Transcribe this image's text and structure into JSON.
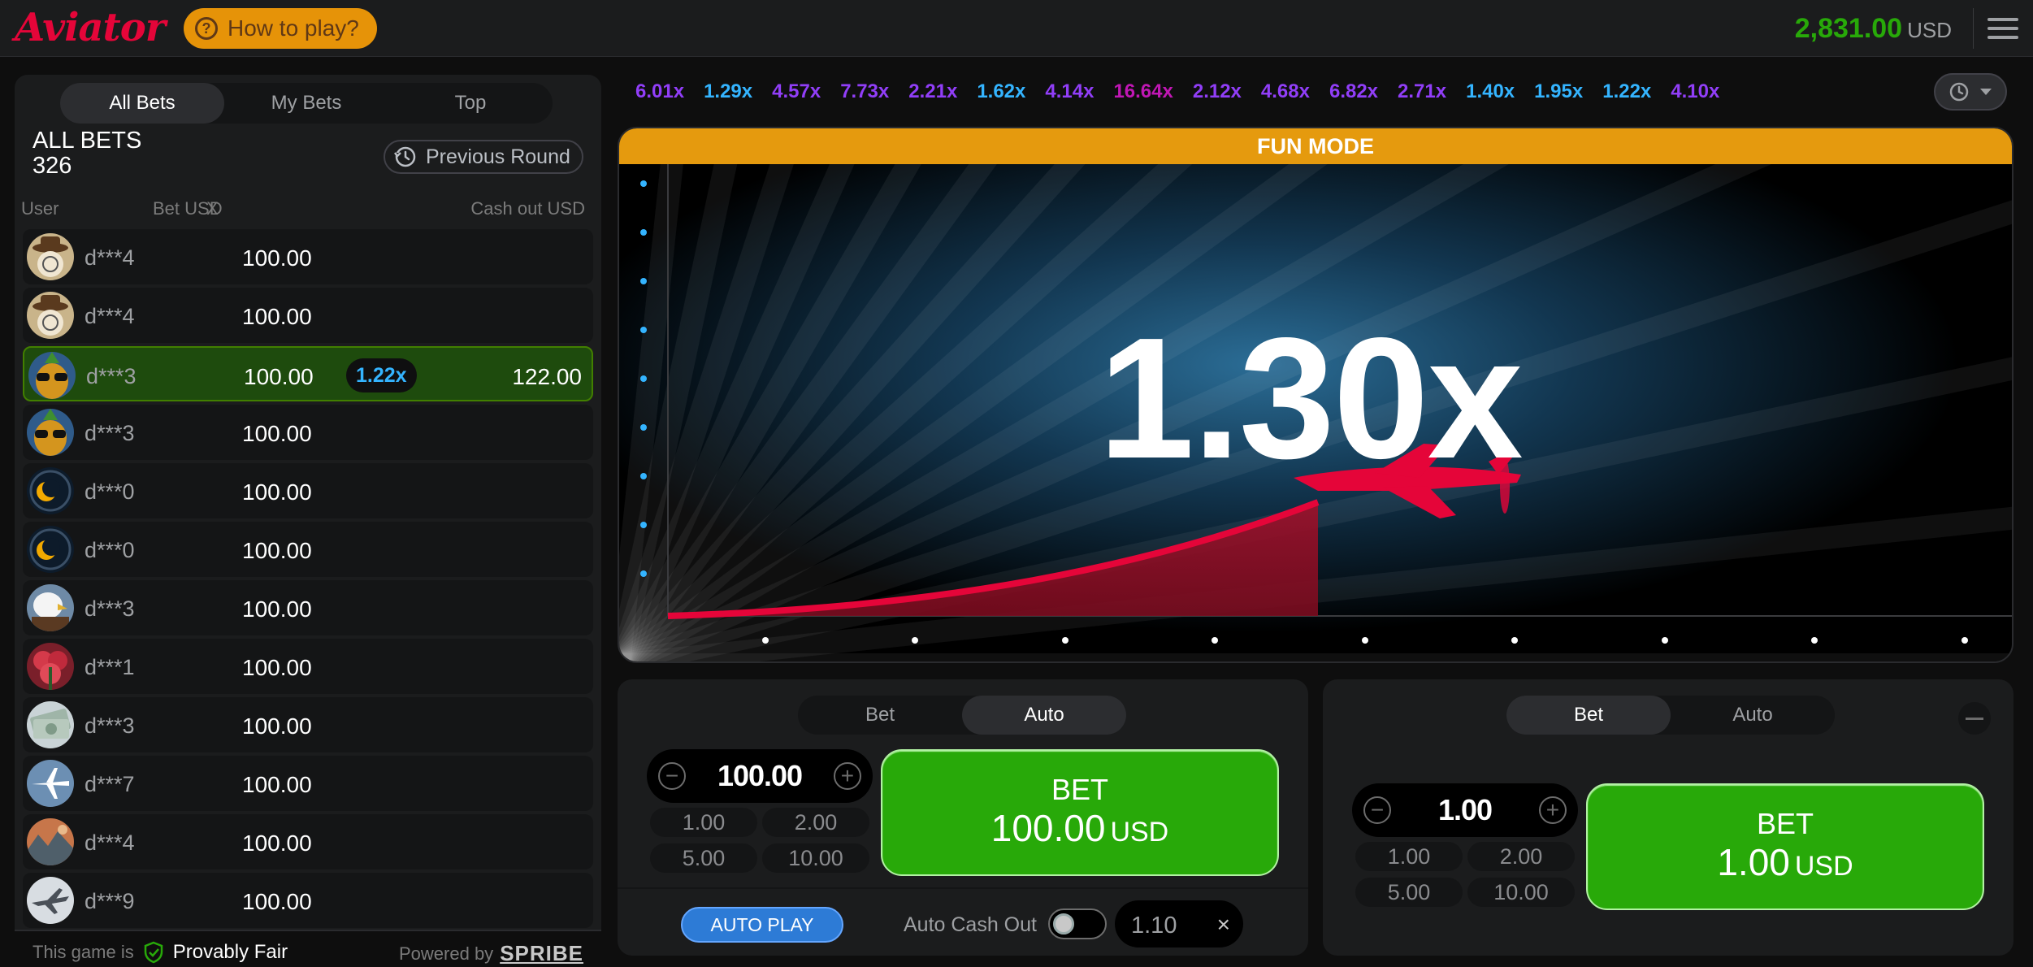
{
  "header": {
    "logo": "Aviator",
    "how_to_play": "How to play?",
    "balance": "2,831.00",
    "currency": "USD"
  },
  "left_panel": {
    "tabs": [
      "All Bets",
      "My Bets",
      "Top"
    ],
    "active_tab": "All Bets",
    "title": "ALL BETS",
    "count": "326",
    "previous_round": "Previous Round",
    "columns": {
      "user": "User",
      "bet": "Bet USD",
      "x": "X",
      "cashout": "Cash out USD"
    },
    "rows": [
      {
        "user": "d***4",
        "bet": "100.00",
        "mult": "",
        "cashout": "",
        "avatar": "cowboy-emoji-avatar",
        "win": false
      },
      {
        "user": "d***4",
        "bet": "100.00",
        "mult": "",
        "cashout": "",
        "avatar": "cowboy-emoji-avatar",
        "win": false
      },
      {
        "user": "d***3",
        "bet": "100.00",
        "mult": "1.22x",
        "cashout": "122.00",
        "avatar": "pineapple-sunglasses-avatar",
        "win": true
      },
      {
        "user": "d***3",
        "bet": "100.00",
        "mult": "",
        "cashout": "",
        "avatar": "pineapple-sunglasses-avatar",
        "win": false
      },
      {
        "user": "d***0",
        "bet": "100.00",
        "mult": "",
        "cashout": "",
        "avatar": "moon-avatar",
        "win": false
      },
      {
        "user": "d***0",
        "bet": "100.00",
        "mult": "",
        "cashout": "",
        "avatar": "moon-avatar",
        "win": false
      },
      {
        "user": "d***3",
        "bet": "100.00",
        "mult": "",
        "cashout": "",
        "avatar": "eagle-avatar",
        "win": false
      },
      {
        "user": "d***1",
        "bet": "100.00",
        "mult": "",
        "cashout": "",
        "avatar": "red-flower-avatar",
        "win": false
      },
      {
        "user": "d***3",
        "bet": "100.00",
        "mult": "",
        "cashout": "",
        "avatar": "dollar-bills-avatar",
        "win": false
      },
      {
        "user": "d***7",
        "bet": "100.00",
        "mult": "",
        "cashout": "",
        "avatar": "airplane-avatar",
        "win": false
      },
      {
        "user": "d***4",
        "bet": "100.00",
        "mult": "",
        "cashout": "",
        "avatar": "rock-landscape-avatar",
        "win": false
      },
      {
        "user": "d***9",
        "bet": "100.00",
        "mult": "",
        "cashout": "",
        "avatar": "fighter-jet-avatar",
        "win": false
      }
    ],
    "footer": {
      "game_is": "This game is",
      "provably_fair": "Provably Fair",
      "powered_by": "Powered by",
      "brand": "SPRIBE"
    }
  },
  "history": [
    {
      "value": "6.01x",
      "color": "#913ef8"
    },
    {
      "value": "1.29x",
      "color": "#34b4ff"
    },
    {
      "value": "4.57x",
      "color": "#913ef8"
    },
    {
      "value": "7.73x",
      "color": "#913ef8"
    },
    {
      "value": "2.21x",
      "color": "#913ef8"
    },
    {
      "value": "1.62x",
      "color": "#34b4ff"
    },
    {
      "value": "4.14x",
      "color": "#913ef8"
    },
    {
      "value": "16.64x",
      "color": "#c017b4"
    },
    {
      "value": "2.12x",
      "color": "#913ef8"
    },
    {
      "value": "4.68x",
      "color": "#913ef8"
    },
    {
      "value": "6.82x",
      "color": "#913ef8"
    },
    {
      "value": "2.71x",
      "color": "#913ef8"
    },
    {
      "value": "1.40x",
      "color": "#34b4ff"
    },
    {
      "value": "1.95x",
      "color": "#34b4ff"
    },
    {
      "value": "1.22x",
      "color": "#34b4ff"
    },
    {
      "value": "4.10x",
      "color": "#913ef8"
    }
  ],
  "game": {
    "mode_banner": "FUN MODE",
    "multiplier": "1.30x",
    "plane_color": "#e50539"
  },
  "panel1": {
    "tabs": [
      "Bet",
      "Auto"
    ],
    "active_tab": "Auto",
    "amount": "100.00",
    "quick": [
      "1.00",
      "2.00",
      "5.00",
      "10.00"
    ],
    "bet_label": "BET",
    "bet_amount": "100.00",
    "currency": "USD",
    "auto_play": "AUTO PLAY",
    "auto_cash_out": "Auto Cash Out",
    "auto_cash_out_enabled": false,
    "auto_cash_out_value": "1.10"
  },
  "panel2": {
    "tabs": [
      "Bet",
      "Auto"
    ],
    "active_tab": "Bet",
    "amount": "1.00",
    "quick": [
      "1.00",
      "2.00",
      "5.00",
      "10.00"
    ],
    "bet_label": "BET",
    "bet_amount": "1.00",
    "currency": "USD"
  }
}
